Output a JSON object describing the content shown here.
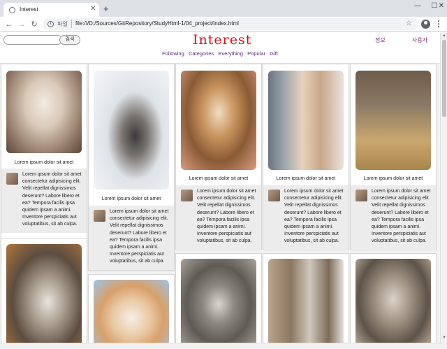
{
  "browser": {
    "tab_title": "Interest",
    "new_tab_symbol": "+",
    "url_scheme": "파일",
    "url": "file:///D:/Sources/GitRepository/StudyHtml-1/04_project/index.html",
    "icons": [
      "favicon-globe-icon",
      "back-icon",
      "forward-icon",
      "reload-icon",
      "info-icon",
      "star-icon",
      "profile-icon",
      "menu-icon",
      "minimize-icon",
      "maximize-icon",
      "close-icon"
    ]
  },
  "header": {
    "search_placeholder": "",
    "search_button": "검색",
    "logo": "Interest",
    "link_info": "정보",
    "link_user": "사용자"
  },
  "nav": {
    "items": [
      "Following",
      "Categories",
      "Everything",
      "Popular",
      "Gift"
    ]
  },
  "cards": [
    {
      "title": "Lorem ipsum dolor sit amet",
      "desc": "Lorem ipsum dolor sit amet consectetur adipisicing elit. Velit repellat dignissimos deserunt? Labore libero et ea? Tempora facilis ipsa quidem ipsam a animi. Inventore perspiciatis aut voluptatibus, sit ab culpa."
    },
    {
      "title": "Lorem ipsum dolor sit amet",
      "desc": "Lorem ipsum dolor sit amet consectetur adipisicing elit. Velit repellat dignissimos deserunt? Labore libero et ea? Tempora facilis ipsa quidem ipsam a animi. Inventore perspiciatis aut voluptatibus, sit ab culpa."
    },
    {
      "title": "Lorem ipsum dolor sit amet",
      "desc": "Lorem ipsum dolor sit amet consectetur adipisicing elit. Velit repellat dignissimos deserunt? Labore libero et ea? Tempora facilis ipsa quidem ipsam a animi. Inventore perspiciatis aut voluptatibus, sit ab culpa."
    },
    {
      "title": "Lorem ipsum dolor sit amet",
      "desc": "Lorem ipsum dolor sit amet consectetur adipisicing elit. Velit repellat dignissimos deserunt? Labore libero et ea? Tempora facilis ipsa quidem ipsam a animi. Inventore perspiciatis aut voluptatibus, sit ab culpa."
    },
    {
      "title": "Lorem ipsum dolor sit amet",
      "desc": "Lorem ipsum dolor sit amet consectetur adipisicing elit. Velit repellat dignissimos deserunt? Labore libero et ea? Tempora facilis ipsa quidem ipsam a animi. Inventore perspiciatis aut voluptatibus, sit ab culpa."
    }
  ],
  "photo_subjects": [
    "kitten-sleeping",
    "kitten-on-snow",
    "kitten-in-hand",
    "kitten-orange-white",
    "kittens-pair-basket",
    "kitten-calico",
    "kitten-white-orange",
    "kitten-tabby-closeup",
    "kitten-tabby-mirror",
    "kitten-tabby-standing"
  ]
}
